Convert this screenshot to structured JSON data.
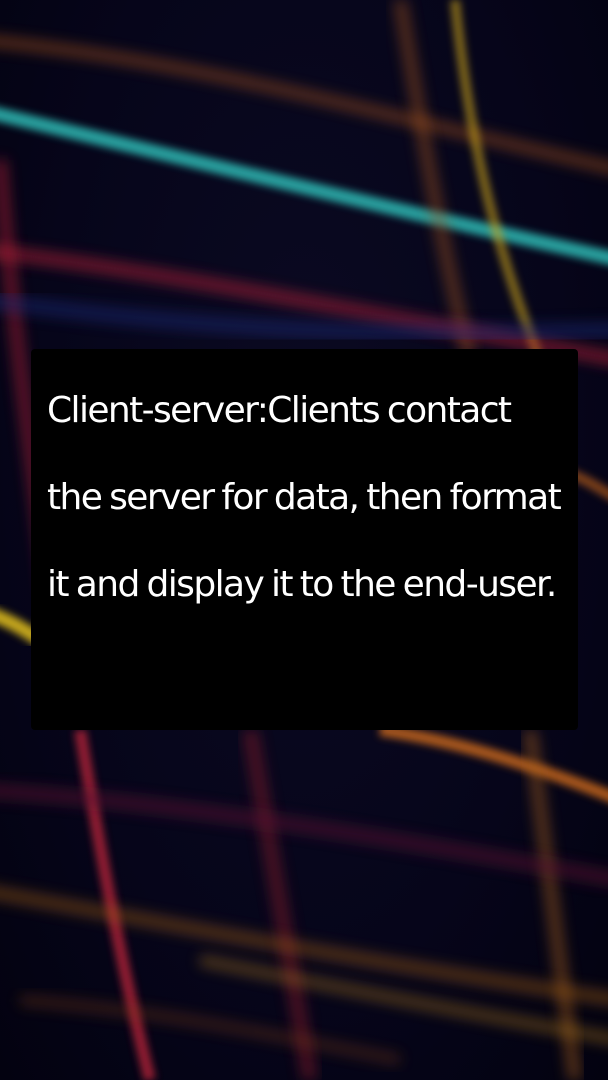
{
  "caption": {
    "text": "Client-server:Clients contact the server for data, then format it and display it to the end-user."
  },
  "background": {
    "description_colors": {
      "base": "#05040f",
      "cyan": "#2fb9b4",
      "red": "#c0283a",
      "orange": "#e0731e",
      "yellow": "#e5c21a"
    }
  }
}
